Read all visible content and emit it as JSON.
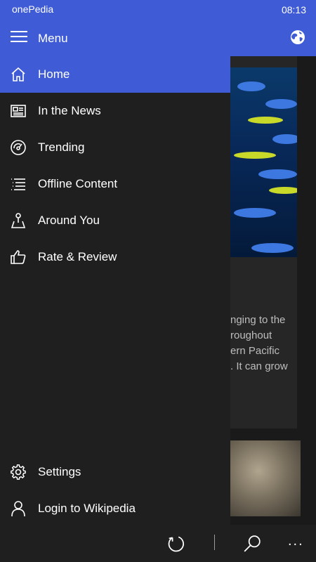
{
  "status_bar": {
    "app_name": "onePedia",
    "time": "08:13"
  },
  "top_bar": {
    "title": "Menu",
    "hamburger_icon": "hamburger-icon",
    "globe_icon": "globe-icon"
  },
  "drawer": {
    "items": [
      {
        "label": "Home",
        "icon": "home-icon",
        "active": true
      },
      {
        "label": "In the News",
        "icon": "newspaper-icon"
      },
      {
        "label": "Trending",
        "icon": "speedometer-icon"
      },
      {
        "label": "Offline Content",
        "icon": "list-icon"
      },
      {
        "label": "Around You",
        "icon": "map-pin-icon"
      },
      {
        "label": "Rate & Review",
        "icon": "thumbs-up-icon"
      }
    ],
    "footer_items": [
      {
        "label": "Settings",
        "icon": "gear-icon"
      },
      {
        "label": "Login to Wikipedia",
        "icon": "person-icon"
      }
    ]
  },
  "article_peek": {
    "lines": [
      "nging to the",
      "roughout",
      "ern Pacific",
      ". It can grow"
    ]
  },
  "app_bar": {
    "refresh_icon": "refresh-icon",
    "search_icon": "search-icon",
    "more_label": "..."
  },
  "colors": {
    "accent": "#3f5bd5",
    "background": "#1f1f1f"
  }
}
